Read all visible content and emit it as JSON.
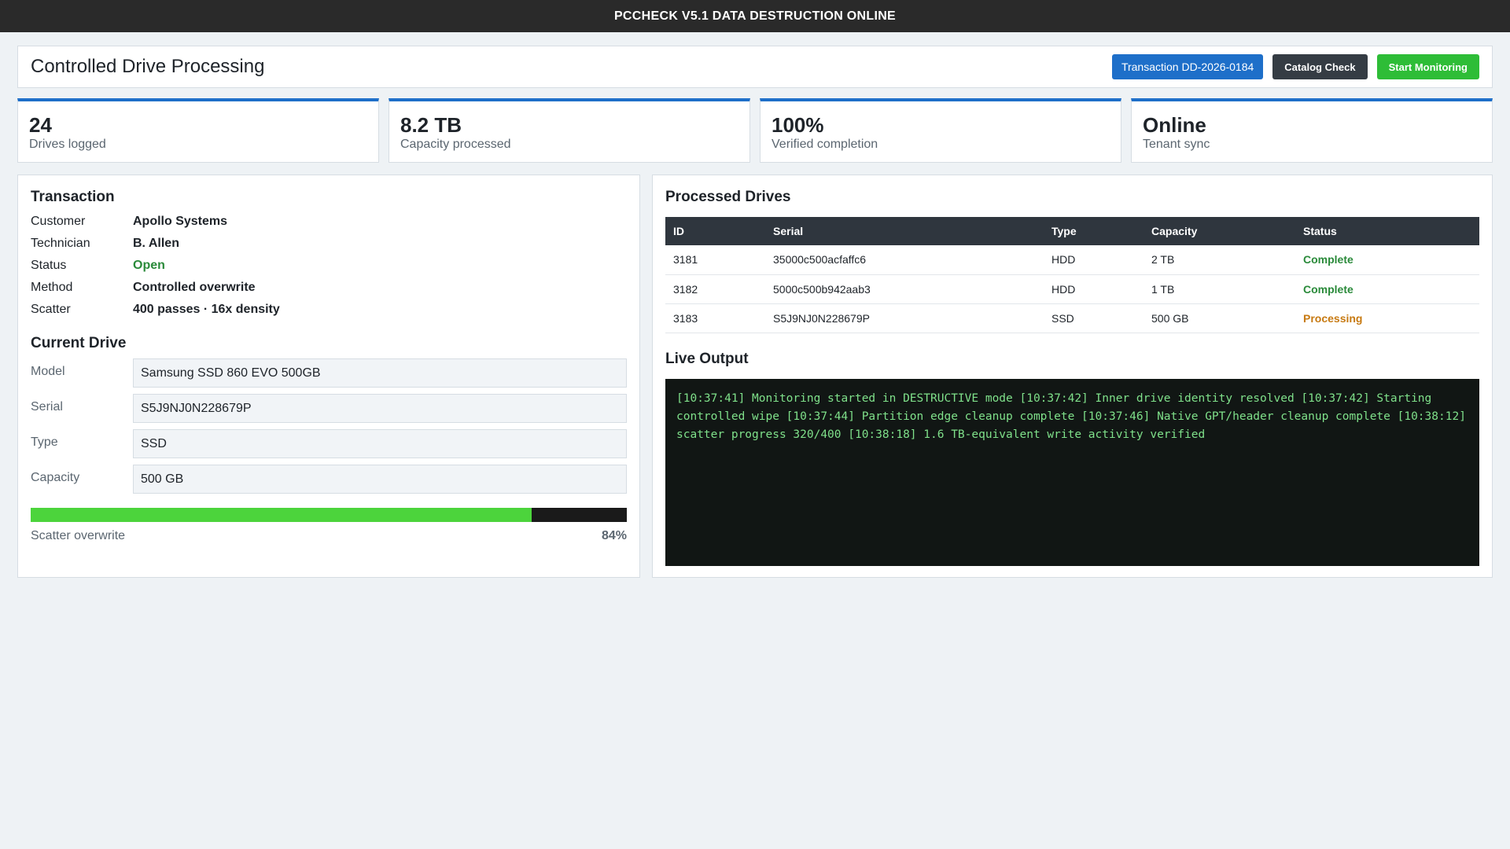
{
  "app": {
    "title": "PCCHECK V5.1 DATA DESTRUCTION ONLINE"
  },
  "header": {
    "page_title": "Controlled Drive Processing",
    "transaction_button": "Transaction DD-2026-0184",
    "catalog_button": "Catalog Check",
    "start_button": "Start Monitoring"
  },
  "stats": [
    {
      "value": "24",
      "label": "Drives logged"
    },
    {
      "value": "8.2 TB",
      "label": "Capacity processed"
    },
    {
      "value": "100%",
      "label": "Verified completion"
    },
    {
      "value": "Online",
      "label": "Tenant sync"
    }
  ],
  "transaction": {
    "title": "Transaction",
    "rows": [
      {
        "key": "Customer",
        "value": "Apollo Systems"
      },
      {
        "key": "Technician",
        "value": "B. Allen"
      },
      {
        "key": "Status",
        "value": "Open"
      },
      {
        "key": "Method",
        "value": "Controlled overwrite"
      },
      {
        "key": "Scatter",
        "value": "400 passes · 16x density"
      }
    ]
  },
  "current_drive": {
    "title": "Current Drive",
    "fields": [
      {
        "label": "Model",
        "value": "Samsung SSD 860 EVO 500GB"
      },
      {
        "label": "Serial",
        "value": "S5J9NJ0N228679P"
      },
      {
        "label": "Type",
        "value": "SSD"
      },
      {
        "label": "Capacity",
        "value": "500 GB"
      }
    ],
    "progress_label": "Scatter overwrite",
    "progress_text": "84%",
    "progress_value": 0.84
  },
  "processed": {
    "title": "Processed Drives",
    "columns": [
      "ID",
      "Serial",
      "Type",
      "Capacity",
      "Status"
    ],
    "rows": [
      {
        "id": "3181",
        "serial": "35000c500acfaffc6",
        "type": "HDD",
        "capacity": "2 TB",
        "status": "Complete"
      },
      {
        "id": "3182",
        "serial": "5000c500b942aab3",
        "type": "HDD",
        "capacity": "1 TB",
        "status": "Complete"
      },
      {
        "id": "3183",
        "serial": "S5J9NJ0N228679P",
        "type": "SSD",
        "capacity": "500 GB",
        "status": "Processing"
      }
    ]
  },
  "live_output": {
    "title": "Live Output",
    "text": "[10:37:41] Monitoring started in DESTRUCTIVE mode [10:37:42] Inner drive identity resolved [10:37:42] Starting controlled wipe [10:37:44] Partition edge cleanup complete [10:37:46] Native GPT/header cleanup complete [10:38:12] scatter progress 320/400 [10:38:18] 1.6 TB-equivalent write activity verified"
  },
  "colors": {
    "accent": "#1e6fc9",
    "success": "#2ebd37",
    "status_complete": "#2a8a3a",
    "status_processing": "#c77a12",
    "terminal_text": "#7fe08a"
  }
}
